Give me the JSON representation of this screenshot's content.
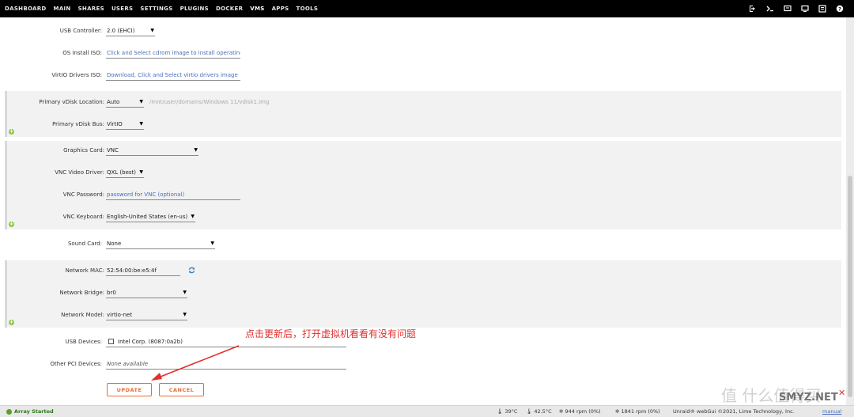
{
  "nav": {
    "items": [
      "DASHBOARD",
      "MAIN",
      "SHARES",
      "USERS",
      "SETTINGS",
      "PLUGINS",
      "DOCKER",
      "VMS",
      "APPS",
      "TOOLS"
    ],
    "active": "VMS"
  },
  "top_icons": [
    "logout-icon",
    "terminal-icon",
    "feedback-icon",
    "monitor-icon",
    "notifications-icon",
    "help-icon"
  ],
  "form": {
    "usb_controller": {
      "label": "USB Controller:",
      "value": "2.0 (EHCI)"
    },
    "os_install_iso": {
      "label": "OS Install ISO:",
      "placeholder": "Click and Select cdrom image to install operating sy"
    },
    "virtio_iso": {
      "label": "VirtIO Drivers ISO:",
      "placeholder": "Download, Click and Select virtio drivers image"
    },
    "vdisk_location": {
      "label": "Primary vDisk Location:",
      "value": "Auto",
      "path": "/mnt/user/domains/Windows 11/vdisk1.img"
    },
    "vdisk_bus": {
      "label": "Primary vDisk Bus:",
      "value": "VirtIO"
    },
    "graphics_card": {
      "label": "Graphics Card:",
      "value": "VNC"
    },
    "vnc_driver": {
      "label": "VNC Video Driver:",
      "value": "QXL (best)"
    },
    "vnc_password": {
      "label": "VNC Password:",
      "placeholder": "password for VNC (optional)"
    },
    "vnc_keyboard": {
      "label": "VNC Keyboard:",
      "value": "English-United States (en-us)"
    },
    "sound_card": {
      "label": "Sound Card:",
      "value": "None"
    },
    "network_mac": {
      "label": "Network MAC:",
      "value": "52:54:00:be:e5:4f"
    },
    "network_bridge": {
      "label": "Network Bridge:",
      "value": "br0"
    },
    "network_model": {
      "label": "Network Model:",
      "value": "virtio-net"
    },
    "usb_devices": {
      "label": "USB Devices:",
      "value": "Intel Corp. (8087:0a2b)"
    },
    "pci_devices": {
      "label": "Other PCI Devices:",
      "value": "None available"
    }
  },
  "buttons": {
    "update": "UPDATE",
    "cancel": "CANCEL"
  },
  "annotation": "点击更新后，打开虚拟机看看有没有问题",
  "status": {
    "array": "Array Started",
    "cpu_temp": "39°C",
    "mb_temp": "42.5°C",
    "fan1": "944 rpm (0%)",
    "fan2": "1841 rpm (0%)",
    "footer": "Unraid® webGui ©2021, Lime Technology, Inc.",
    "manual": "manual"
  },
  "watermark": {
    "text": "值 什么值得买",
    "site": "SMYZ.NET"
  },
  "colors": {
    "accent": "#e76d33",
    "link": "#486dba",
    "plus": "#8cc34b",
    "annotation": "#e03030"
  }
}
